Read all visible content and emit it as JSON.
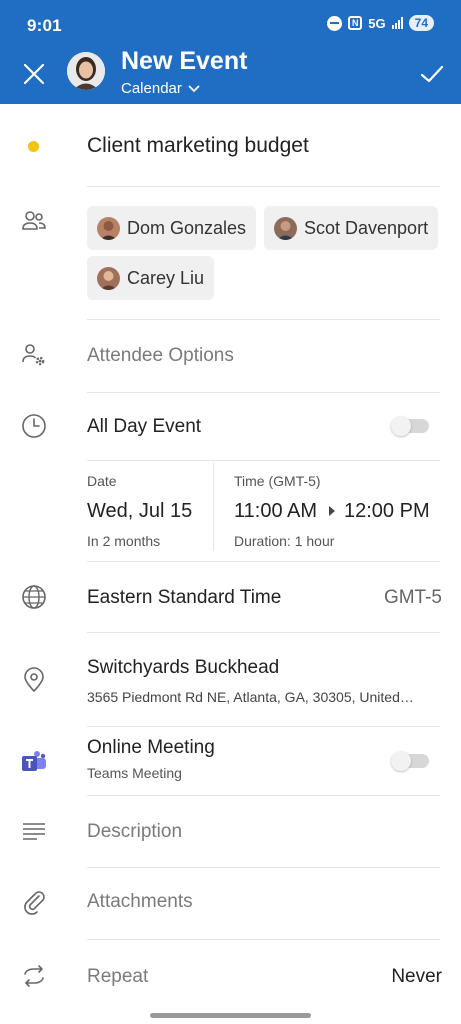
{
  "status_bar": {
    "time": "9:01",
    "network": "5G",
    "battery": "74"
  },
  "header": {
    "title": "New Event",
    "calendar_label": "Calendar",
    "accent_color": "#1f6ec4"
  },
  "event": {
    "title": "Client marketing budget",
    "category_color": "#f1c40f",
    "attendees": [
      {
        "name": "Dom Gonzales"
      },
      {
        "name": "Scot Davenport"
      },
      {
        "name": "Carey Liu"
      }
    ],
    "attendee_options_label": "Attendee Options",
    "all_day": {
      "label": "All Day Event",
      "on": false
    },
    "date": {
      "label": "Date",
      "value": "Wed, Jul 15",
      "relative": "In 2 months"
    },
    "time": {
      "label": "Time (GMT-5)",
      "start": "11:00 AM",
      "end": "12:00 PM",
      "duration": "Duration: 1 hour"
    },
    "timezone": {
      "name": "Eastern Standard Time",
      "offset": "GMT-5"
    },
    "location": {
      "name": "Switchyards Buckhead",
      "address": "3565 Piedmont Rd NE, Atlanta, GA, 30305, United…"
    },
    "online_meeting": {
      "label": "Online Meeting",
      "provider": "Teams Meeting",
      "on": false
    },
    "description_placeholder": "Description",
    "attachments_label": "Attachments",
    "repeat": {
      "label": "Repeat",
      "value": "Never"
    }
  },
  "icons": {
    "close": "close-icon",
    "confirm": "checkmark-icon",
    "chevron": "chevron-down-icon",
    "people": "people-icon",
    "people_settings": "people-settings-icon",
    "clock": "clock-icon",
    "globe": "globe-icon",
    "location": "location-pin-icon",
    "teams": "teams-icon",
    "description": "text-lines-icon",
    "attachment": "paperclip-icon",
    "repeat": "repeat-icon"
  }
}
